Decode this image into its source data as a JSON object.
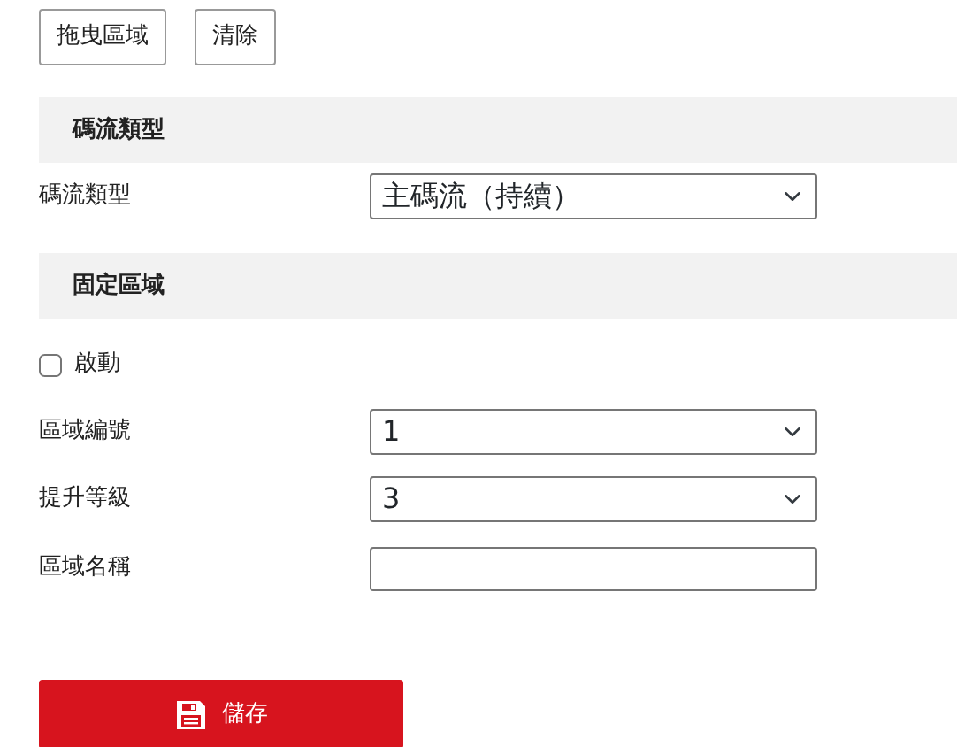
{
  "toolbar": {
    "buttons": [
      "拖曳區域",
      "清除"
    ]
  },
  "sections": [
    {
      "title": "碼流類型",
      "fields": [
        {
          "kind": "select",
          "label": "碼流類型",
          "value": "主碼流（持續）"
        }
      ]
    },
    {
      "title": "固定區域",
      "fields": [
        {
          "kind": "checkbox",
          "label": "啟動",
          "checked": false
        },
        {
          "kind": "select",
          "label": "區域編號",
          "value": "1"
        },
        {
          "kind": "select",
          "label": "提升等級",
          "value": "3"
        },
        {
          "kind": "text",
          "label": "區域名稱"
        }
      ]
    }
  ],
  "save_button": {
    "label": "儲存"
  }
}
